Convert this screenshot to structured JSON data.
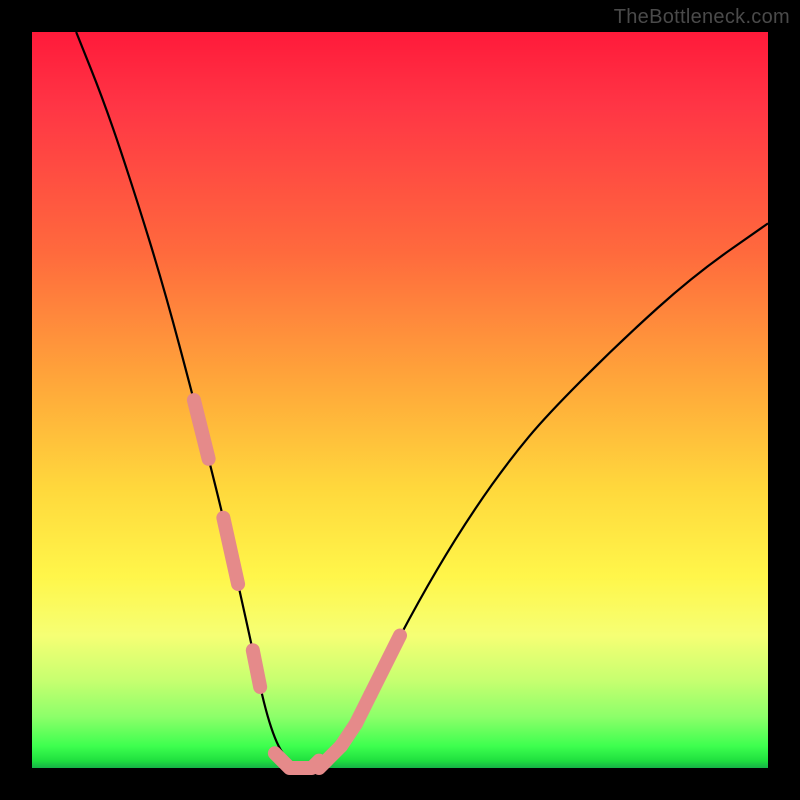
{
  "watermark": "TheBottleneck.com",
  "chart_data": {
    "type": "line",
    "title": "",
    "xlabel": "",
    "ylabel": "",
    "xlim": [
      0,
      100
    ],
    "ylim": [
      0,
      100
    ],
    "series": [
      {
        "name": "bottleneck-curve",
        "x": [
          6,
          10,
          14,
          18,
          22,
          24,
          26,
          28,
          30,
          31,
          32,
          33,
          34,
          35,
          36,
          37,
          38,
          39,
          40,
          42,
          44,
          46,
          50,
          55,
          60,
          65,
          70,
          80,
          90,
          100
        ],
        "y": [
          100,
          90,
          78,
          65,
          50,
          42,
          34,
          25,
          16,
          11,
          7,
          4,
          2,
          1,
          0,
          0,
          0,
          0,
          1,
          3,
          6,
          10,
          18,
          27,
          35,
          42,
          48,
          58,
          67,
          74
        ],
        "color": "#000000"
      }
    ],
    "overlay": {
      "name": "pink-dash-region",
      "color": "#e58a8a",
      "left_branch": {
        "x": [
          22,
          24,
          26,
          28,
          30,
          31
        ],
        "y": [
          50,
          42,
          34,
          25,
          16,
          11
        ],
        "gaps_after_index": [
          1,
          3
        ]
      },
      "right_branch": {
        "x": [
          39,
          40,
          42,
          44,
          46,
          50
        ],
        "y": [
          0,
          1,
          3,
          6,
          10,
          18
        ],
        "gaps_after_index": []
      },
      "bottom_band": {
        "x": [
          33,
          34,
          35,
          36,
          37,
          38,
          39
        ],
        "y": [
          2,
          1,
          0,
          0,
          0,
          0,
          1
        ]
      }
    }
  }
}
